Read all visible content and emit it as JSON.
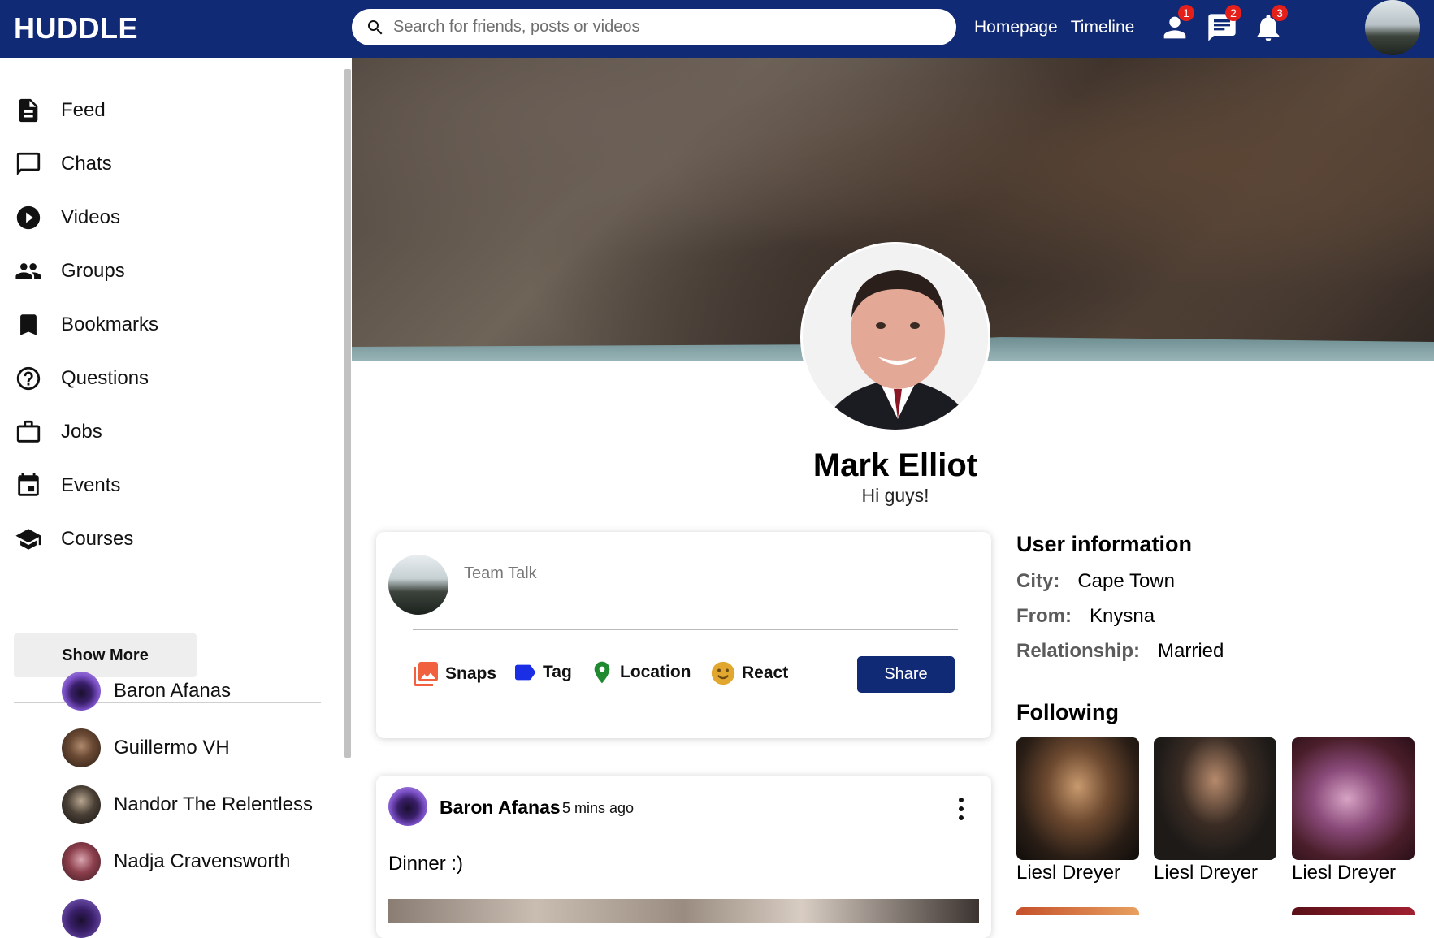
{
  "header": {
    "logo": "HUDDLE",
    "search_placeholder": "Search for friends, posts or videos",
    "links": [
      "Homepage",
      "Timeline"
    ],
    "icons": [
      {
        "name": "person-icon",
        "badge": "1"
      },
      {
        "name": "chat-icon",
        "badge": "2"
      },
      {
        "name": "bell-icon",
        "badge": "3"
      }
    ]
  },
  "sidebar": {
    "items": [
      {
        "label": "Feed",
        "icon": "feed-icon"
      },
      {
        "label": "Chats",
        "icon": "chat-icon"
      },
      {
        "label": "Videos",
        "icon": "play-icon"
      },
      {
        "label": "Groups",
        "icon": "group-icon"
      },
      {
        "label": "Bookmarks",
        "icon": "bookmark-icon"
      },
      {
        "label": "Questions",
        "icon": "help-icon"
      },
      {
        "label": "Jobs",
        "icon": "work-icon"
      },
      {
        "label": "Events",
        "icon": "event-icon"
      },
      {
        "label": "Courses",
        "icon": "school-icon"
      }
    ],
    "show_more": "Show More",
    "friends": [
      "Baron Afanas",
      "Guillermo VH",
      "Nandor The Relentless",
      "Nadja Cravensworth"
    ]
  },
  "profile": {
    "name": "Mark Elliot",
    "status": "Hi guys!"
  },
  "composer": {
    "placeholder": "Team Talk",
    "options": [
      "Snaps",
      "Tag",
      "Location",
      "React"
    ],
    "share": "Share"
  },
  "post": {
    "author": "Baron Afanas",
    "time": "5 mins ago",
    "text": "Dinner :)"
  },
  "user_info": {
    "title": "User information",
    "rows": [
      {
        "key": "City:",
        "value": "Cape Town"
      },
      {
        "key": "From:",
        "value": "Knysna"
      },
      {
        "key": "Relationship:",
        "value": "Married"
      }
    ]
  },
  "following": {
    "title": "Following",
    "people": [
      "Liesl Dreyer",
      "Liesl Dreyer",
      "Liesl Dreyer"
    ]
  },
  "colors": {
    "brand": "#112a75",
    "badge": "#e5201b"
  }
}
